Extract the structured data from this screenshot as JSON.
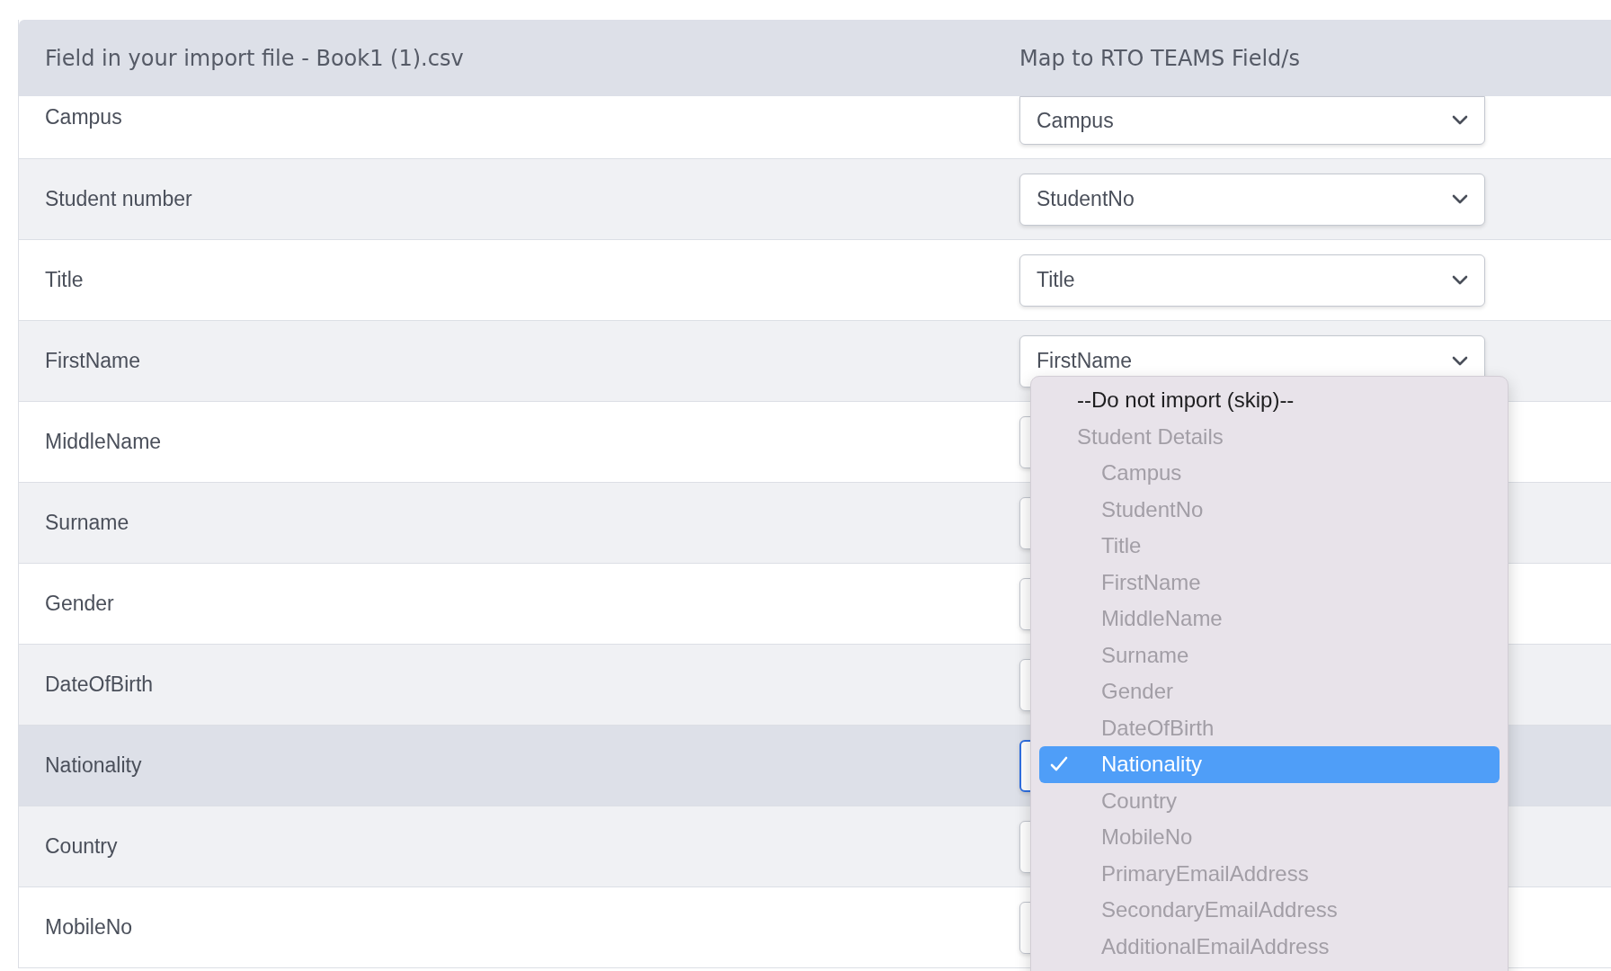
{
  "table": {
    "columns": [
      "Field in your import file - Book1 (1).csv",
      "Map to RTO TEAMS Field/s"
    ],
    "rows": [
      {
        "field": "Campus",
        "mapping": "Campus",
        "selected": false,
        "focused": false
      },
      {
        "field": "Student number",
        "mapping": "StudentNo",
        "selected": false,
        "focused": false
      },
      {
        "field": "Title",
        "mapping": "Title",
        "selected": false,
        "focused": false
      },
      {
        "field": "FirstName",
        "mapping": "FirstName",
        "selected": false,
        "focused": false
      },
      {
        "field": "MiddleName",
        "selected": false,
        "focused": false
      },
      {
        "field": "Surname",
        "selected": false,
        "focused": false
      },
      {
        "field": "Gender",
        "selected": false,
        "focused": false
      },
      {
        "field": "DateOfBirth",
        "selected": false,
        "focused": false
      },
      {
        "field": "Nationality",
        "selected": true,
        "focused": true
      },
      {
        "field": "Country",
        "selected": false,
        "focused": false
      },
      {
        "field": "MobileNo",
        "selected": false,
        "focused": false
      }
    ]
  },
  "dropdown": {
    "items": [
      {
        "kind": "option",
        "label": "--Do not import (skip)--",
        "selected": false,
        "disabled": false
      },
      {
        "kind": "group",
        "label": "Student Details",
        "children": [
          {
            "label": "Campus",
            "selected": false,
            "disabled": true
          },
          {
            "label": "StudentNo",
            "selected": false,
            "disabled": true
          },
          {
            "label": "Title",
            "selected": false,
            "disabled": true
          },
          {
            "label": "FirstName",
            "selected": false,
            "disabled": true
          },
          {
            "label": "MiddleName",
            "selected": false,
            "disabled": true
          },
          {
            "label": "Surname",
            "selected": false,
            "disabled": true
          },
          {
            "label": "Gender",
            "selected": false,
            "disabled": true
          },
          {
            "label": "DateOfBirth",
            "selected": false,
            "disabled": true
          },
          {
            "label": "Nationality",
            "selected": true,
            "disabled": false
          },
          {
            "label": "Country",
            "selected": false,
            "disabled": true
          },
          {
            "label": "MobileNo",
            "selected": false,
            "disabled": true
          },
          {
            "label": "PrimaryEmailAddress",
            "selected": false,
            "disabled": true
          },
          {
            "label": "SecondaryEmailAddress",
            "selected": false,
            "disabled": true
          },
          {
            "label": "AdditionalEmailAddress",
            "selected": false,
            "disabled": true
          }
        ]
      }
    ]
  }
}
